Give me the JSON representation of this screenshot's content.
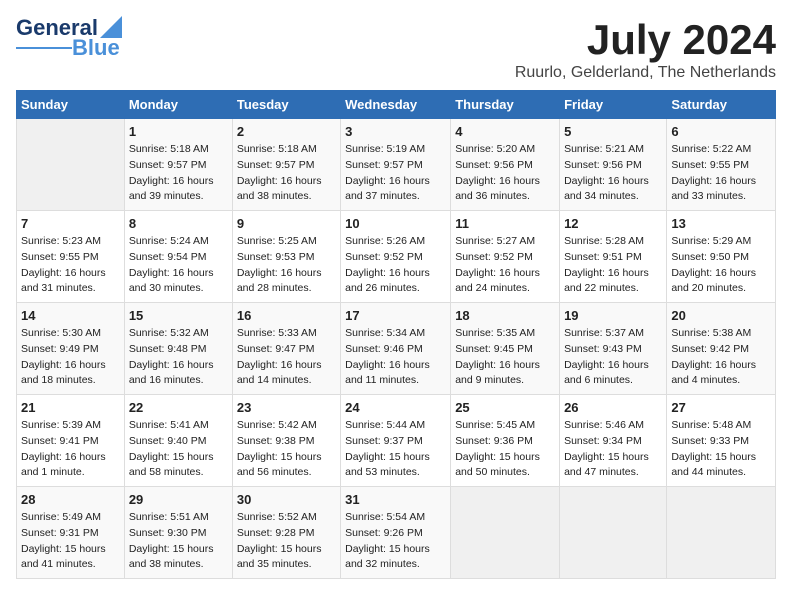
{
  "logo": {
    "line1": "General",
    "line2": "Blue"
  },
  "title": "July 2024",
  "location": "Ruurlo, Gelderland, The Netherlands",
  "weekdays": [
    "Sunday",
    "Monday",
    "Tuesday",
    "Wednesday",
    "Thursday",
    "Friday",
    "Saturday"
  ],
  "weeks": [
    [
      {
        "day": "",
        "info": ""
      },
      {
        "day": "1",
        "info": "Sunrise: 5:18 AM\nSunset: 9:57 PM\nDaylight: 16 hours\nand 39 minutes."
      },
      {
        "day": "2",
        "info": "Sunrise: 5:18 AM\nSunset: 9:57 PM\nDaylight: 16 hours\nand 38 minutes."
      },
      {
        "day": "3",
        "info": "Sunrise: 5:19 AM\nSunset: 9:57 PM\nDaylight: 16 hours\nand 37 minutes."
      },
      {
        "day": "4",
        "info": "Sunrise: 5:20 AM\nSunset: 9:56 PM\nDaylight: 16 hours\nand 36 minutes."
      },
      {
        "day": "5",
        "info": "Sunrise: 5:21 AM\nSunset: 9:56 PM\nDaylight: 16 hours\nand 34 minutes."
      },
      {
        "day": "6",
        "info": "Sunrise: 5:22 AM\nSunset: 9:55 PM\nDaylight: 16 hours\nand 33 minutes."
      }
    ],
    [
      {
        "day": "7",
        "info": "Sunrise: 5:23 AM\nSunset: 9:55 PM\nDaylight: 16 hours\nand 31 minutes."
      },
      {
        "day": "8",
        "info": "Sunrise: 5:24 AM\nSunset: 9:54 PM\nDaylight: 16 hours\nand 30 minutes."
      },
      {
        "day": "9",
        "info": "Sunrise: 5:25 AM\nSunset: 9:53 PM\nDaylight: 16 hours\nand 28 minutes."
      },
      {
        "day": "10",
        "info": "Sunrise: 5:26 AM\nSunset: 9:52 PM\nDaylight: 16 hours\nand 26 minutes."
      },
      {
        "day": "11",
        "info": "Sunrise: 5:27 AM\nSunset: 9:52 PM\nDaylight: 16 hours\nand 24 minutes."
      },
      {
        "day": "12",
        "info": "Sunrise: 5:28 AM\nSunset: 9:51 PM\nDaylight: 16 hours\nand 22 minutes."
      },
      {
        "day": "13",
        "info": "Sunrise: 5:29 AM\nSunset: 9:50 PM\nDaylight: 16 hours\nand 20 minutes."
      }
    ],
    [
      {
        "day": "14",
        "info": "Sunrise: 5:30 AM\nSunset: 9:49 PM\nDaylight: 16 hours\nand 18 minutes."
      },
      {
        "day": "15",
        "info": "Sunrise: 5:32 AM\nSunset: 9:48 PM\nDaylight: 16 hours\nand 16 minutes."
      },
      {
        "day": "16",
        "info": "Sunrise: 5:33 AM\nSunset: 9:47 PM\nDaylight: 16 hours\nand 14 minutes."
      },
      {
        "day": "17",
        "info": "Sunrise: 5:34 AM\nSunset: 9:46 PM\nDaylight: 16 hours\nand 11 minutes."
      },
      {
        "day": "18",
        "info": "Sunrise: 5:35 AM\nSunset: 9:45 PM\nDaylight: 16 hours\nand 9 minutes."
      },
      {
        "day": "19",
        "info": "Sunrise: 5:37 AM\nSunset: 9:43 PM\nDaylight: 16 hours\nand 6 minutes."
      },
      {
        "day": "20",
        "info": "Sunrise: 5:38 AM\nSunset: 9:42 PM\nDaylight: 16 hours\nand 4 minutes."
      }
    ],
    [
      {
        "day": "21",
        "info": "Sunrise: 5:39 AM\nSunset: 9:41 PM\nDaylight: 16 hours\nand 1 minute."
      },
      {
        "day": "22",
        "info": "Sunrise: 5:41 AM\nSunset: 9:40 PM\nDaylight: 15 hours\nand 58 minutes."
      },
      {
        "day": "23",
        "info": "Sunrise: 5:42 AM\nSunset: 9:38 PM\nDaylight: 15 hours\nand 56 minutes."
      },
      {
        "day": "24",
        "info": "Sunrise: 5:44 AM\nSunset: 9:37 PM\nDaylight: 15 hours\nand 53 minutes."
      },
      {
        "day": "25",
        "info": "Sunrise: 5:45 AM\nSunset: 9:36 PM\nDaylight: 15 hours\nand 50 minutes."
      },
      {
        "day": "26",
        "info": "Sunrise: 5:46 AM\nSunset: 9:34 PM\nDaylight: 15 hours\nand 47 minutes."
      },
      {
        "day": "27",
        "info": "Sunrise: 5:48 AM\nSunset: 9:33 PM\nDaylight: 15 hours\nand 44 minutes."
      }
    ],
    [
      {
        "day": "28",
        "info": "Sunrise: 5:49 AM\nSunset: 9:31 PM\nDaylight: 15 hours\nand 41 minutes."
      },
      {
        "day": "29",
        "info": "Sunrise: 5:51 AM\nSunset: 9:30 PM\nDaylight: 15 hours\nand 38 minutes."
      },
      {
        "day": "30",
        "info": "Sunrise: 5:52 AM\nSunset: 9:28 PM\nDaylight: 15 hours\nand 35 minutes."
      },
      {
        "day": "31",
        "info": "Sunrise: 5:54 AM\nSunset: 9:26 PM\nDaylight: 15 hours\nand 32 minutes."
      },
      {
        "day": "",
        "info": ""
      },
      {
        "day": "",
        "info": ""
      },
      {
        "day": "",
        "info": ""
      }
    ]
  ]
}
